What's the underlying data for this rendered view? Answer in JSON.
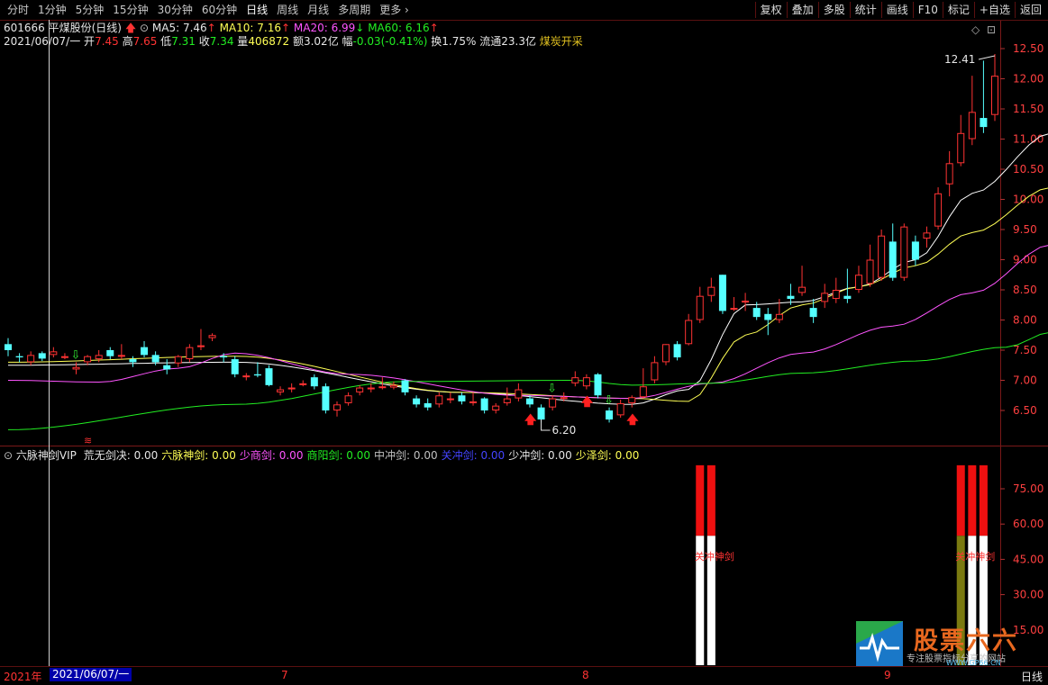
{
  "toolbar": {
    "periods": [
      "分时",
      "1分钟",
      "5分钟",
      "15分钟",
      "30分钟",
      "60分钟",
      "日线",
      "周线",
      "月线",
      "多周期",
      "更多"
    ],
    "active_period": "日线",
    "buttons": [
      "复权",
      "叠加",
      "多股",
      "统计",
      "画线",
      "F10",
      "标记",
      "+自选",
      "返回"
    ]
  },
  "quote": {
    "code_name": "601666 平煤股份(日线)",
    "ma5": "MA5: 7.46",
    "ma10": "MA10: 7.16",
    "ma20": "MA20: 6.99",
    "ma60": "MA60: 6.16",
    "date": "2021/06/07/一",
    "open_label": "开",
    "open": "7.45",
    "high_label": "高",
    "high": "7.65",
    "low_label": "低",
    "low": "7.31",
    "close_label": "收",
    "close": "7.34",
    "vol_label": "量",
    "vol": "406872",
    "amount_label": "额",
    "amount": "3.02亿",
    "change_label": "幅",
    "change": "-0.03(-0.41%)",
    "turnover_label": "换",
    "turnover": "1.75%",
    "float_label": "流通",
    "float_cap": "23.3亿",
    "sector": "煤炭开采"
  },
  "indicator": {
    "name": "六脉神剑VIP",
    "items": [
      {
        "label": "荒无剑决:",
        "value": "0.00"
      },
      {
        "label": "六脉神剑:",
        "value": "0.00"
      },
      {
        "label": "少商剑:",
        "value": "0.00"
      },
      {
        "label": "商阳剑:",
        "value": "0.00"
      },
      {
        "label": "中冲剑:",
        "value": "0.00"
      },
      {
        "label": "关冲剑:",
        "value": "0.00"
      },
      {
        "label": "少冲剑:",
        "value": "0.00"
      },
      {
        "label": "少泽剑:",
        "value": "0.00"
      }
    ],
    "signal_label_a": "关冲神剑",
    "signal_label_b": "关冲神剑",
    "y_ticks": [
      "75.00",
      "60.00",
      "45.00",
      "30.00",
      "15.00"
    ]
  },
  "axis": {
    "y_ticks": [
      "12.50",
      "12.00",
      "11.50",
      "11.00",
      "10.50",
      "10.00",
      "9.50",
      "9.00",
      "8.50",
      "8.00",
      "7.50",
      "7.00",
      "6.50"
    ]
  },
  "annotations": {
    "high": "12.41",
    "low": "6.20"
  },
  "dates": {
    "year": "2021年",
    "cursor": "2021/06/07/一",
    "m7": "7",
    "m8": "8",
    "m9": "9",
    "period": "日线"
  },
  "logo": {
    "title": "股票六六",
    "subtitle": "专注股票指标分享的网站",
    "url": "WWW.GP66.CN"
  },
  "colors": {
    "up": "#ff3333",
    "down": "#55ffff",
    "ma5": "#ffffff",
    "ma10": "#ffff55",
    "ma20": "#ff55ff",
    "ma60": "#22ee22"
  },
  "chart_data": {
    "type": "candlestick",
    "price_range": [
      6.0,
      12.7
    ],
    "candles": [
      [
        7.6,
        7.5,
        7.7,
        7.4
      ],
      [
        7.4,
        7.38,
        7.45,
        7.3
      ],
      [
        7.3,
        7.42,
        7.48,
        7.25
      ],
      [
        7.45,
        7.36,
        7.48,
        7.32
      ],
      [
        7.42,
        7.48,
        7.55,
        7.38
      ],
      [
        7.4,
        7.4,
        7.45,
        7.35
      ],
      [
        7.18,
        7.22,
        7.3,
        7.1
      ],
      [
        7.3,
        7.4,
        7.42,
        7.25
      ],
      [
        7.35,
        7.42,
        7.5,
        7.3
      ],
      [
        7.5,
        7.4,
        7.55,
        7.35
      ],
      [
        7.4,
        7.42,
        7.6,
        7.35
      ],
      [
        7.35,
        7.3,
        7.4,
        7.22
      ],
      [
        7.55,
        7.42,
        7.65,
        7.38
      ],
      [
        7.42,
        7.3,
        7.48,
        7.25
      ],
      [
        7.25,
        7.18,
        7.35,
        7.1
      ],
      [
        7.28,
        7.4,
        7.42,
        7.22
      ],
      [
        7.35,
        7.55,
        7.6,
        7.3
      ],
      [
        7.55,
        7.58,
        7.85,
        7.5
      ],
      [
        7.7,
        7.75,
        7.78,
        7.65
      ],
      [
        7.4,
        7.38,
        7.45,
        7.3
      ],
      [
        7.35,
        7.1,
        7.4,
        7.05
      ],
      [
        7.05,
        7.08,
        7.12,
        7.0
      ],
      [
        7.1,
        7.08,
        7.3,
        7.05
      ],
      [
        7.2,
        6.92,
        7.25,
        6.9
      ],
      [
        6.8,
        6.85,
        6.9,
        6.75
      ],
      [
        6.85,
        6.88,
        6.95,
        6.8
      ],
      [
        6.95,
        6.95,
        7.0,
        6.9
      ],
      [
        7.05,
        6.9,
        7.1,
        6.85
      ],
      [
        6.9,
        6.5,
        6.95,
        6.45
      ],
      [
        6.5,
        6.6,
        6.65,
        6.4
      ],
      [
        6.62,
        6.75,
        6.8,
        6.58
      ],
      [
        6.8,
        6.88,
        6.92,
        6.75
      ],
      [
        6.85,
        6.88,
        6.95,
        6.8
      ],
      [
        6.88,
        6.9,
        7.05,
        6.85
      ],
      [
        6.88,
        6.92,
        6.98,
        6.85
      ],
      [
        7.0,
        6.8,
        7.02,
        6.75
      ],
      [
        6.7,
        6.6,
        6.75,
        6.55
      ],
      [
        6.62,
        6.55,
        6.7,
        6.5
      ],
      [
        6.6,
        6.75,
        6.8,
        6.55
      ],
      [
        6.68,
        6.7,
        6.8,
        6.62
      ],
      [
        6.75,
        6.65,
        6.8,
        6.6
      ],
      [
        6.65,
        6.65,
        6.8,
        6.58
      ],
      [
        6.7,
        6.5,
        6.72,
        6.45
      ],
      [
        6.5,
        6.58,
        6.62,
        6.45
      ],
      [
        6.62,
        6.7,
        6.88,
        6.58
      ],
      [
        6.7,
        6.85,
        6.95,
        6.65
      ],
      [
        6.7,
        6.6,
        6.75,
        6.55
      ],
      [
        6.55,
        6.35,
        6.6,
        6.3
      ],
      [
        6.55,
        6.7,
        6.75,
        6.5
      ],
      [
        6.72,
        6.72,
        6.8,
        6.65
      ],
      [
        6.95,
        7.05,
        7.15,
        6.9
      ],
      [
        6.9,
        7.05,
        7.1,
        6.85
      ],
      [
        7.1,
        6.75,
        7.12,
        6.7
      ],
      [
        6.5,
        6.35,
        6.55,
        6.3
      ],
      [
        6.42,
        6.62,
        6.68,
        6.38
      ],
      [
        6.62,
        6.72,
        6.75,
        6.55
      ],
      [
        6.72,
        6.9,
        7.2,
        6.7
      ],
      [
        7.0,
        7.3,
        7.4,
        6.95
      ],
      [
        7.3,
        7.6,
        7.6,
        7.25
      ],
      [
        7.6,
        7.38,
        7.65,
        7.33
      ],
      [
        7.6,
        8.0,
        8.1,
        7.58
      ],
      [
        8.0,
        8.4,
        8.55,
        7.95
      ],
      [
        8.4,
        8.55,
        8.7,
        8.3
      ],
      [
        8.75,
        8.15,
        8.75,
        8.1
      ],
      [
        8.2,
        8.2,
        8.38,
        8.15
      ],
      [
        8.3,
        8.32,
        8.45,
        8.15
      ],
      [
        8.2,
        8.05,
        8.3,
        8.0
      ],
      [
        8.1,
        8.0,
        8.2,
        7.75
      ],
      [
        8.0,
        8.1,
        8.35,
        7.95
      ],
      [
        8.4,
        8.35,
        8.6,
        8.25
      ],
      [
        8.45,
        8.55,
        8.9,
        8.4
      ],
      [
        8.2,
        8.05,
        8.35,
        7.95
      ],
      [
        8.3,
        8.45,
        8.6,
        8.2
      ],
      [
        8.35,
        8.5,
        8.7,
        8.28
      ],
      [
        8.4,
        8.35,
        8.85,
        8.28
      ],
      [
        8.5,
        8.75,
        8.9,
        8.45
      ],
      [
        8.6,
        9.0,
        9.25,
        8.55
      ],
      [
        8.7,
        9.4,
        9.5,
        8.65
      ],
      [
        9.3,
        8.7,
        9.6,
        8.65
      ],
      [
        8.7,
        9.55,
        9.6,
        8.65
      ],
      [
        9.3,
        9.0,
        9.4,
        8.9
      ],
      [
        9.35,
        9.45,
        9.55,
        9.2
      ],
      [
        9.55,
        10.1,
        10.2,
        9.5
      ],
      [
        10.25,
        10.6,
        10.8,
        10.05
      ],
      [
        10.6,
        11.1,
        11.4,
        10.55
      ],
      [
        11.0,
        11.45,
        12.05,
        10.9
      ],
      [
        11.35,
        11.2,
        12.3,
        11.1
      ],
      [
        11.4,
        12.05,
        12.41,
        11.3
      ]
    ],
    "ma": {
      "MA5": [
        [
          0,
          7.25
        ],
        [
          20,
          7.3
        ],
        [
          40,
          6.8
        ],
        [
          55,
          6.6
        ],
        [
          60,
          6.85
        ],
        [
          65,
          8.25
        ],
        [
          70,
          8.3
        ],
        [
          75,
          8.55
        ],
        [
          80,
          9.0
        ],
        [
          85,
          10.1
        ],
        [
          92,
          11.1
        ]
      ],
      "MA10": [
        [
          0,
          7.3
        ],
        [
          20,
          7.4
        ],
        [
          40,
          6.8
        ],
        [
          55,
          6.7
        ],
        [
          60,
          6.65
        ],
        [
          65,
          7.75
        ],
        [
          70,
          8.25
        ],
        [
          75,
          8.55
        ],
        [
          80,
          8.9
        ],
        [
          85,
          9.45
        ],
        [
          92,
          10.2
        ]
      ],
      "MA20": [
        [
          0,
          7.0
        ],
        [
          8,
          6.97
        ],
        [
          15,
          7.2
        ],
        [
          20,
          7.45
        ],
        [
          30,
          7.1
        ],
        [
          45,
          6.75
        ],
        [
          55,
          6.7
        ],
        [
          62,
          6.95
        ],
        [
          70,
          7.45
        ],
        [
          78,
          7.9
        ],
        [
          85,
          8.45
        ],
        [
          92,
          9.25
        ]
      ],
      "MA60": [
        [
          0,
          6.18
        ],
        [
          20,
          6.6
        ],
        [
          35,
          6.98
        ],
        [
          50,
          7.0
        ],
        [
          55,
          6.92
        ],
        [
          62,
          6.95
        ],
        [
          70,
          7.12
        ],
        [
          80,
          7.32
        ],
        [
          88,
          7.55
        ],
        [
          92,
          7.8
        ]
      ]
    },
    "indicator_signals": [
      {
        "index": 61,
        "top": 85,
        "mid": 55
      },
      {
        "index": 62,
        "top": 85,
        "mid": 55
      },
      {
        "index": 84,
        "top": 85,
        "mid": 55,
        "olive": true
      },
      {
        "index": 85,
        "top": 85,
        "mid": 55
      },
      {
        "index": 86,
        "top": 85,
        "mid": 55
      }
    ],
    "indicator_range": [
      0,
      90
    ]
  }
}
